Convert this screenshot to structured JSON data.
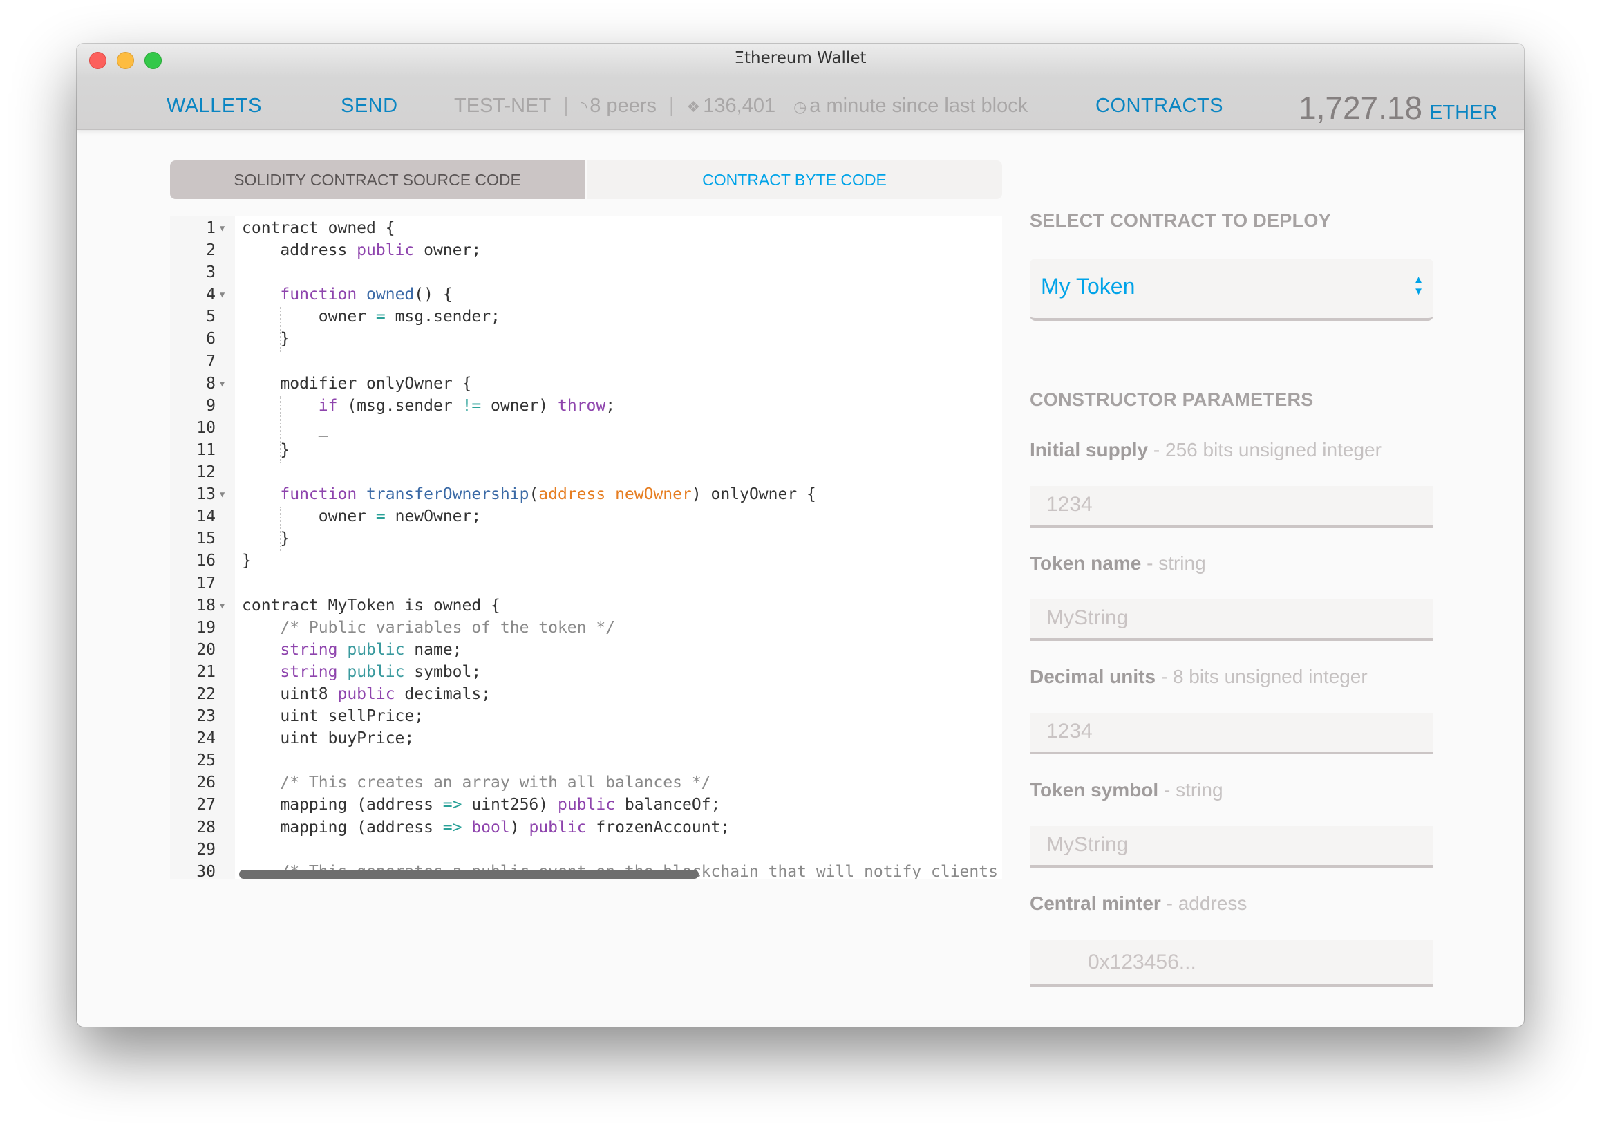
{
  "window": {
    "title": "Ξthereum Wallet"
  },
  "nav": {
    "wallets": "WALLETS",
    "send": "SEND",
    "network": "TEST-NET",
    "peers": "8 peers",
    "block_number": "136,401",
    "last_block": "a minute since last block",
    "contracts": "CONTRACTS",
    "balance_amount": "1,727.18",
    "balance_unit": "ETHER",
    "peers_icon": "wifi-icon",
    "blocks_icon": "layers-icon",
    "time_icon": "clock-icon"
  },
  "tabs": {
    "source": "SOLIDITY CONTRACT SOURCE CODE",
    "bytecode": "CONTRACT BYTE CODE",
    "active": "source"
  },
  "editor": {
    "lines": [
      {
        "n": "1",
        "fold": true,
        "segs": [
          [
            "",
            "contract owned {"
          ]
        ]
      },
      {
        "n": "2",
        "segs": [
          [
            "",
            "    address "
          ],
          [
            "kw",
            "public"
          ],
          [
            "",
            " owner;"
          ]
        ]
      },
      {
        "n": "3",
        "segs": []
      },
      {
        "n": "4",
        "fold": true,
        "segs": [
          [
            "",
            "    "
          ],
          [
            "kw",
            "function"
          ],
          [
            "",
            " "
          ],
          [
            "fn",
            "owned"
          ],
          [
            "",
            "() {"
          ]
        ]
      },
      {
        "n": "5",
        "segs": [
          [
            "",
            "        owner "
          ],
          [
            "op",
            "="
          ],
          [
            "",
            " msg.sender;"
          ]
        ]
      },
      {
        "n": "6",
        "segs": [
          [
            "",
            "    }"
          ]
        ]
      },
      {
        "n": "7",
        "segs": []
      },
      {
        "n": "8",
        "fold": true,
        "segs": [
          [
            "",
            "    modifier onlyOwner {"
          ]
        ]
      },
      {
        "n": "9",
        "segs": [
          [
            "",
            "        "
          ],
          [
            "kw",
            "if"
          ],
          [
            "",
            " (msg.sender "
          ],
          [
            "op",
            "!="
          ],
          [
            "",
            " owner) "
          ],
          [
            "kw",
            "throw"
          ],
          [
            "",
            ";"
          ]
        ]
      },
      {
        "n": "10",
        "segs": [
          [
            "",
            "        _"
          ]
        ]
      },
      {
        "n": "11",
        "segs": [
          [
            "",
            "    }"
          ]
        ]
      },
      {
        "n": "12",
        "segs": []
      },
      {
        "n": "13",
        "fold": true,
        "segs": [
          [
            "",
            "    "
          ],
          [
            "kw",
            "function"
          ],
          [
            "",
            " "
          ],
          [
            "fn",
            "transferOwnership"
          ],
          [
            "",
            "("
          ],
          [
            "par",
            "address newOwner"
          ],
          [
            "",
            ") onlyOwner {"
          ]
        ]
      },
      {
        "n": "14",
        "segs": [
          [
            "",
            "        owner "
          ],
          [
            "op",
            "="
          ],
          [
            "",
            " newOwner;"
          ]
        ]
      },
      {
        "n": "15",
        "segs": [
          [
            "",
            "    }"
          ]
        ]
      },
      {
        "n": "16",
        "segs": [
          [
            "",
            "}"
          ]
        ]
      },
      {
        "n": "17",
        "segs": []
      },
      {
        "n": "18",
        "fold": true,
        "segs": [
          [
            "",
            "contract MyToken is owned {"
          ]
        ]
      },
      {
        "n": "19",
        "segs": [
          [
            "cm",
            "    /* Public variables of the token */"
          ]
        ]
      },
      {
        "n": "20",
        "segs": [
          [
            "",
            "    "
          ],
          [
            "kw",
            "string"
          ],
          [
            "",
            " "
          ],
          [
            "tl",
            "public"
          ],
          [
            "",
            " name;"
          ]
        ]
      },
      {
        "n": "21",
        "segs": [
          [
            "",
            "    "
          ],
          [
            "kw",
            "string"
          ],
          [
            "",
            " "
          ],
          [
            "tl",
            "public"
          ],
          [
            "",
            " symbol;"
          ]
        ]
      },
      {
        "n": "22",
        "segs": [
          [
            "",
            "    uint8 "
          ],
          [
            "kw",
            "public"
          ],
          [
            "",
            " decimals;"
          ]
        ]
      },
      {
        "n": "23",
        "segs": [
          [
            "",
            "    uint sellPrice;"
          ]
        ]
      },
      {
        "n": "24",
        "segs": [
          [
            "",
            "    uint buyPrice;"
          ]
        ]
      },
      {
        "n": "25",
        "segs": []
      },
      {
        "n": "26",
        "segs": [
          [
            "cm",
            "    /* This creates an array with all balances */"
          ]
        ]
      },
      {
        "n": "27",
        "segs": [
          [
            "",
            "    mapping (address "
          ],
          [
            "op",
            "=>"
          ],
          [
            "",
            " uint256) "
          ],
          [
            "kw",
            "public"
          ],
          [
            "",
            " balanceOf;"
          ]
        ]
      },
      {
        "n": "28",
        "segs": [
          [
            "",
            "    mapping (address "
          ],
          [
            "op",
            "=>"
          ],
          [
            "",
            " "
          ],
          [
            "kw",
            "bool"
          ],
          [
            "",
            ") "
          ],
          [
            "kw",
            "public"
          ],
          [
            "",
            " frozenAccount;"
          ]
        ]
      },
      {
        "n": "29",
        "segs": []
      },
      {
        "n": "30",
        "segs": [
          [
            "cm",
            "    /* This generates a public event on the blockchain that will notify clients */"
          ]
        ]
      }
    ]
  },
  "deploy": {
    "select_title": "SELECT CONTRACT TO DEPLOY",
    "selected_contract": "My Token",
    "params_title": "CONSTRUCTOR PARAMETERS",
    "params": [
      {
        "name": "Initial supply",
        "type": " - 256 bits unsigned integer",
        "placeholder": "1234"
      },
      {
        "name": "Token name",
        "type": " - string",
        "placeholder": "MyString"
      },
      {
        "name": "Decimal units",
        "type": " - 8 bits unsigned integer",
        "placeholder": "1234"
      },
      {
        "name": "Token symbol",
        "type": " - string",
        "placeholder": "MyString"
      },
      {
        "name": "Central minter",
        "type": " - address",
        "placeholder": "0x123456..."
      }
    ]
  },
  "colors": {
    "accent": "#0a85c2",
    "accent_light": "#00a3e8",
    "keyword": "#8e44ad",
    "function": "#3b6aa6",
    "param": "#e67e22",
    "operator": "#2aa198"
  }
}
